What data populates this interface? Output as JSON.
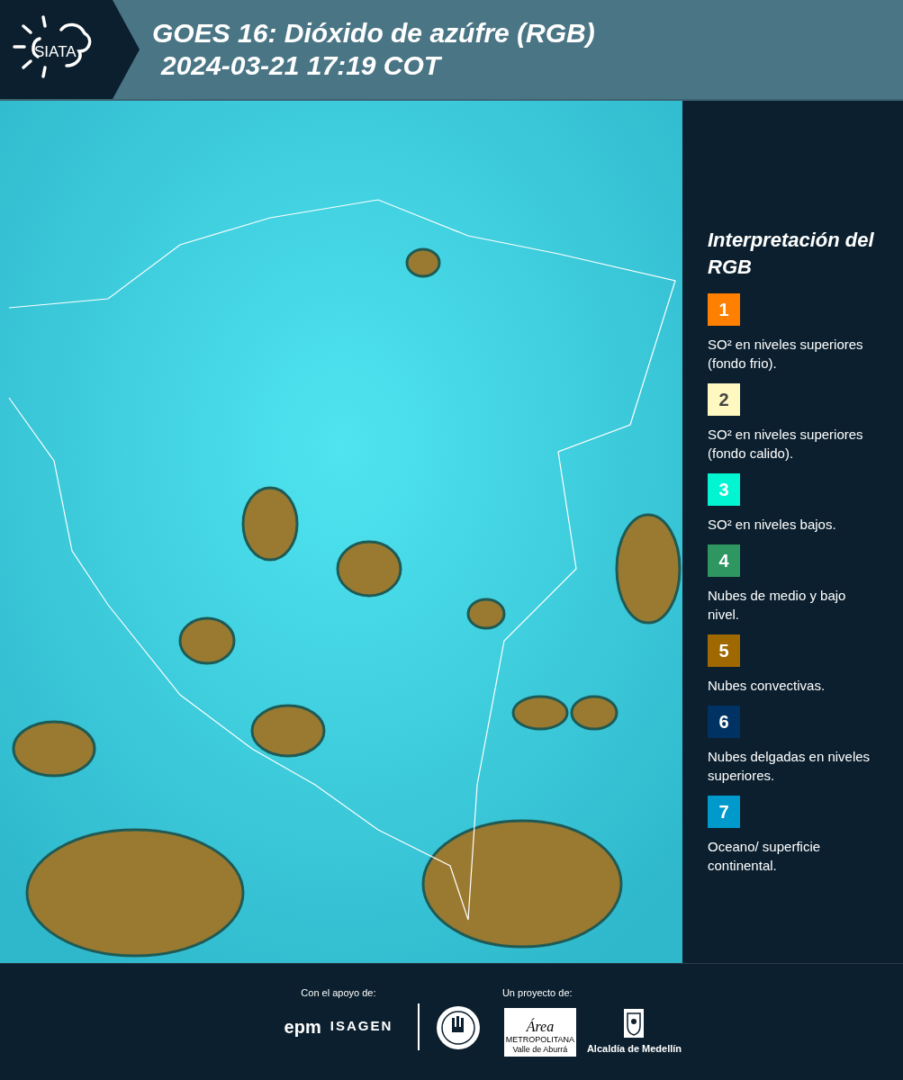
{
  "header": {
    "logo_text": "SIATA",
    "title": "GOES 16: Dióxido de azúfre (RGB)",
    "timestamp": "2024-03-21 17:19 COT"
  },
  "legend": {
    "title": "Interpretación del RGB",
    "items": [
      {
        "number": "1",
        "color": "#ff7f00",
        "text": "SO² en niveles superiores (fondo frio)."
      },
      {
        "number": "2",
        "color": "#fff8c0",
        "text": "SO² en niveles superiores (fondo calido)."
      },
      {
        "number": "3",
        "color": "#00f5d0",
        "text": "SO² en niveles bajos."
      },
      {
        "number": "4",
        "color": "#2e9660",
        "text": "Nubes de medio y bajo nivel."
      },
      {
        "number": "5",
        "color": "#a06800",
        "text": "Nubes convectivas."
      },
      {
        "number": "6",
        "color": "#003264",
        "text": "Nubes delgadas en niveles superiores."
      },
      {
        "number": "7",
        "color": "#0099cc",
        "text": "Oceano/ superficie continental."
      }
    ]
  },
  "footer": {
    "support_label": "Con el apoyo de:",
    "support_logos": [
      "epm",
      "ISAGEN"
    ],
    "project_label": "Un proyecto de:",
    "area_logo": {
      "title": "Área",
      "line1": "METROPOLITANA",
      "line2": "Valle de Aburrá"
    },
    "city_logo": "Alcaldía de Medellín"
  }
}
